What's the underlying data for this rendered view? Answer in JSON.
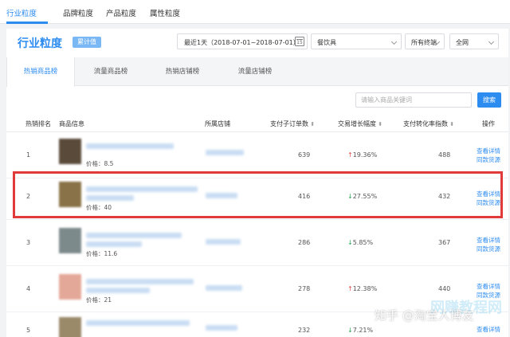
{
  "top_tabs": [
    "行业粒度",
    "品牌粒度",
    "产品粒度",
    "属性粒度"
  ],
  "header": {
    "title": "行业粒度",
    "badge": "累计值",
    "date_range": "最近1天（2018-07-01~2018-07-01）",
    "calendar_day": "15",
    "category": "餐饮具",
    "terminal": "所有终端",
    "network": "全网"
  },
  "sub_tabs": [
    "热销商品榜",
    "流量商品榜",
    "热销店铺榜",
    "流量店铺榜"
  ],
  "search": {
    "placeholder": "请输入商品关键词",
    "button": "搜索"
  },
  "columns": {
    "rank": "热销排名",
    "product": "商品信息",
    "shop": "所属店铺",
    "orders": "支付子订单数",
    "growth": "交易增长幅度",
    "conversion": "支付转化率指数",
    "action": "操作"
  },
  "rows": [
    {
      "rank": "1",
      "price": "价格：8.5",
      "orders": "639",
      "growth": "19.36%",
      "trend": "up",
      "conversion": "488",
      "action1": "查看详情",
      "action2": "同款货源"
    },
    {
      "rank": "2",
      "price": "价格：40",
      "orders": "416",
      "growth": "27.55%",
      "trend": "down",
      "conversion": "432",
      "action1": "查看详情",
      "action2": "同款货源"
    },
    {
      "rank": "3",
      "price": "价格：11.6",
      "orders": "286",
      "growth": "5.85%",
      "trend": "down",
      "conversion": "367",
      "action1": "查看详情",
      "action2": "同款货源"
    },
    {
      "rank": "4",
      "price": "价格：21",
      "orders": "278",
      "growth": "12.38%",
      "trend": "up",
      "conversion": "440",
      "action1": "查看详情",
      "action2": "同款货源"
    },
    {
      "rank": "5",
      "price": "",
      "orders": "232",
      "growth": "7.21%",
      "trend": "down",
      "conversion": "",
      "action1": "查看详情",
      "action2": ""
    }
  ],
  "watermark": "知乎 @淘宝人博友",
  "watermark_bg": "网赚教程网",
  "colors": {
    "accent": "#2d8cf0",
    "highlight": "#e03a3a",
    "up": "#e54b4b",
    "down": "#2aaa5a"
  }
}
